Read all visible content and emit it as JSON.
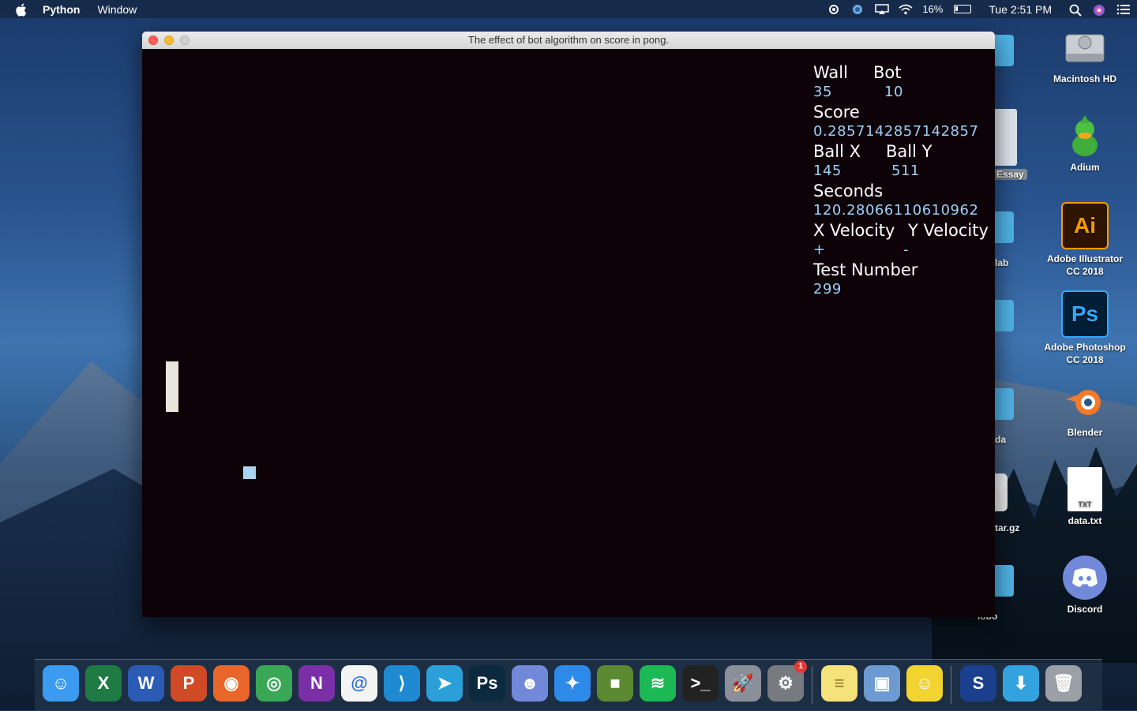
{
  "menubar": {
    "app_name": "Python",
    "menu_window": "Window",
    "battery": "16%",
    "clock": "Tue 2:51 PM"
  },
  "window": {
    "title": "The effect of bot algorithm on score in pong."
  },
  "stats": {
    "wall_label": "Wall",
    "bot_label": "Bot",
    "wall_value": "35",
    "bot_value": "10",
    "score_label": "Score",
    "score_value": "0.2857142857142857",
    "ballx_label": "Ball X",
    "bally_label": "Ball Y",
    "ballx_value": "145",
    "bally_value": "511",
    "seconds_label": "Seconds",
    "seconds_value": "120.28066110610962",
    "xvel_label": "X Velocity",
    "yvel_label": "Y Velocity",
    "xvel_value": "+",
    "yvel_value": "-",
    "test_label": "Test Number",
    "test_value": "299"
  },
  "desktop": {
    "icons": [
      {
        "label": "Macintosh HD",
        "icon": "hard-drive-icon"
      },
      {
        "label": "Adium",
        "icon": "duck-icon"
      },
      {
        "label": "Adobe Illustrator CC 2018",
        "glyph": "Ai",
        "icon": "illustrator-icon"
      },
      {
        "label": "Adobe Photoshop CC 2018",
        "glyph": "Ps",
        "icon": "photoshop-icon"
      },
      {
        "label": "Blender",
        "icon": "blender-icon"
      },
      {
        "label": "data.txt",
        "glyph": "TXT",
        "icon": "text-file-icon"
      },
      {
        "label": "Discord",
        "icon": "discord-icon"
      }
    ],
    "partial_labels": [
      "Essay",
      "lab",
      "da",
      "tar.gz",
      "lobo"
    ]
  },
  "dock": {
    "badge_count": "1",
    "items": [
      {
        "name": "finder",
        "glyph": "☺",
        "color": "#3a9bf0"
      },
      {
        "name": "excel",
        "glyph": "X",
        "color": "#1f7a45"
      },
      {
        "name": "word",
        "glyph": "W",
        "color": "#2b5bb5"
      },
      {
        "name": "powerpoint",
        "glyph": "P",
        "color": "#d04a25"
      },
      {
        "name": "firefox",
        "glyph": "◉",
        "color": "#e8662a"
      },
      {
        "name": "chrome",
        "glyph": "◎",
        "color": "#3aa757"
      },
      {
        "name": "onenote",
        "glyph": "N",
        "color": "#7b2fa6"
      },
      {
        "name": "mail",
        "glyph": "@",
        "color": "#f4f4f4"
      },
      {
        "name": "vscode",
        "glyph": "⟩",
        "color": "#1f8ad2"
      },
      {
        "name": "telegram",
        "glyph": "➤",
        "color": "#2a9fd8"
      },
      {
        "name": "photoshop",
        "glyph": "Ps",
        "color": "#0b2a3f"
      },
      {
        "name": "discord",
        "glyph": "☻",
        "color": "#7289da"
      },
      {
        "name": "safari",
        "glyph": "✦",
        "color": "#2d8ae8"
      },
      {
        "name": "minecraft",
        "glyph": "■",
        "color": "#5c8a32"
      },
      {
        "name": "spotify",
        "glyph": "≋",
        "color": "#1db954"
      },
      {
        "name": "terminal",
        "glyph": ">_",
        "color": "#222222"
      },
      {
        "name": "launchpad",
        "glyph": "🚀",
        "color": "#8a8f99"
      },
      {
        "name": "system-preferences",
        "glyph": "⚙",
        "color": "#777b80"
      },
      {
        "name": "notes",
        "glyph": "≡",
        "color": "#f6e27a"
      },
      {
        "name": "preview",
        "glyph": "▣",
        "color": "#6d9bd1"
      },
      {
        "name": "cyberduck",
        "glyph": "☺",
        "color": "#f2d330"
      },
      {
        "name": "skype",
        "glyph": "S",
        "color": "#1a3f8c"
      },
      {
        "name": "downloads",
        "glyph": "⬇",
        "color": "#33a3e0"
      },
      {
        "name": "trash",
        "glyph": "🗑",
        "color": "#9aa0a6"
      }
    ]
  }
}
